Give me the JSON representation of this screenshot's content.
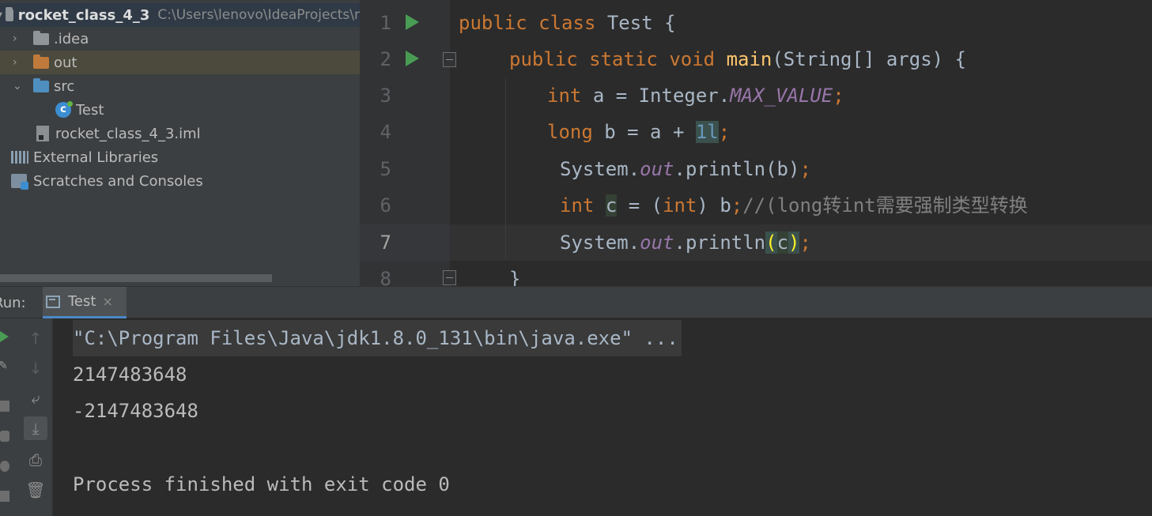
{
  "project": {
    "root_name": "rocket_class_4_3",
    "root_path": "C:\\Users\\lenovo\\IdeaProjects\\r",
    "items": [
      {
        "label": ".idea"
      },
      {
        "label": "out"
      },
      {
        "label": "src"
      },
      {
        "label": "Test"
      },
      {
        "label": "rocket_class_4_3.iml"
      },
      {
        "label": "External Libraries"
      },
      {
        "label": "Scratches and Consoles"
      }
    ]
  },
  "editor": {
    "line_numbers": [
      "1",
      "2",
      "3",
      "4",
      "5",
      "6",
      "7",
      "8"
    ],
    "lines": {
      "l1": {
        "kw1": "public",
        "kw2": "class",
        "rest": "Test {"
      },
      "l2": {
        "kw1": "public",
        "kw2": "static",
        "kw3": "void",
        "fn": "main",
        "rest": "(String[] args) {"
      },
      "l3": {
        "kw": "int",
        "mid": "a = Integer.",
        "field": "MAX_VALUE",
        "semi": ";"
      },
      "l4": {
        "kw": "long",
        "mid": "b = a + ",
        "num": "1l",
        "semi": ";"
      },
      "l5": {
        "pre": "System.",
        "field": "out",
        "post": ".println(b)",
        "semi": ";"
      },
      "l6": {
        "kw": "int",
        "var": "c",
        "mid1": " = (",
        "kw2": "int",
        "mid2": ") b",
        "semi": ";",
        "comment": "//(long转int需要强制类型转换"
      },
      "l7": {
        "pre": "System.",
        "field": "out",
        "post": ".println",
        "open": "(",
        "var": "c",
        "close": ")",
        "semi": ";"
      },
      "l8": {
        "text": "}"
      }
    }
  },
  "run": {
    "label": "Run:",
    "tab": "Test",
    "close": "×",
    "output": [
      "\"C:\\Program Files\\Java\\jdk1.8.0_131\\bin\\java.exe\" ...",
      "2147483648",
      "-2147483648",
      "",
      "Process finished with exit code 0"
    ],
    "tools": [
      "up-arrow",
      "down-arrow",
      "soft-wrap",
      "scroll-to-end",
      "print",
      "trash"
    ]
  }
}
